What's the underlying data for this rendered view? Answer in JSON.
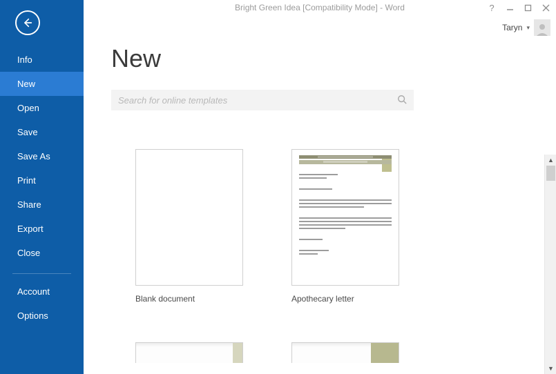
{
  "window": {
    "title": "Bright Green Idea [Compatibility Mode] - Word"
  },
  "user": {
    "name": "Taryn"
  },
  "sidebar": {
    "items": [
      {
        "label": "Info"
      },
      {
        "label": "New"
      },
      {
        "label": "Open"
      },
      {
        "label": "Save"
      },
      {
        "label": "Save As"
      },
      {
        "label": "Print"
      },
      {
        "label": "Share"
      },
      {
        "label": "Export"
      },
      {
        "label": "Close"
      }
    ],
    "items_bottom": [
      {
        "label": "Account"
      },
      {
        "label": "Options"
      }
    ]
  },
  "page": {
    "title": "New",
    "search_placeholder": "Search for online templates"
  },
  "templates": [
    {
      "label": "Blank document"
    },
    {
      "label": "Apothecary letter"
    }
  ]
}
